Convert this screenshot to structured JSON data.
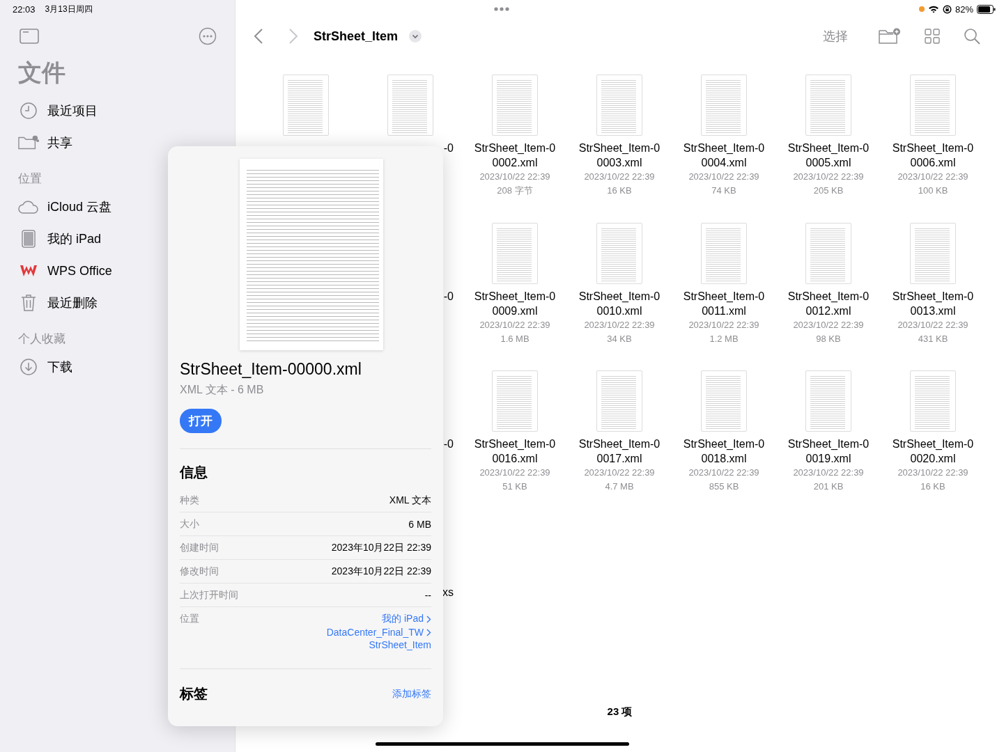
{
  "status_bar": {
    "time": "22:03",
    "date": "3月13日周四",
    "battery": "82%"
  },
  "sidebar": {
    "title": "文件",
    "sections": [
      {
        "items": [
          {
            "label": "最近项目"
          },
          {
            "label": "共享"
          }
        ]
      },
      {
        "header": "位置",
        "items": [
          {
            "label": "iCloud 云盘"
          },
          {
            "label": "我的 iPad"
          },
          {
            "label": "WPS Office"
          },
          {
            "label": "最近删除"
          }
        ]
      },
      {
        "header": "个人收藏",
        "items": [
          {
            "label": "下载"
          }
        ]
      }
    ]
  },
  "toolbar": {
    "title": "StrSheet_Item",
    "select": "选择"
  },
  "grid": [
    [
      {
        "kind": "thumbnail"
      },
      {
        "kind": "thumbnail",
        "fragment": "-0"
      },
      {
        "kind": "file",
        "name_lines": [
          "StrSheet_Item-0",
          "0002.xml"
        ],
        "date": "2023/10/22 22:39",
        "size": "208 字节"
      },
      {
        "kind": "file",
        "name_lines": [
          "StrSheet_Item-0",
          "0003.xml"
        ],
        "date": "2023/10/22 22:39",
        "size": "16 KB"
      },
      {
        "kind": "file",
        "name_lines": [
          "StrSheet_Item-0",
          "0004.xml"
        ],
        "date": "2023/10/22 22:39",
        "size": "74 KB"
      },
      {
        "kind": "file",
        "name_lines": [
          "StrSheet_Item-0",
          "0005.xml"
        ],
        "date": "2023/10/22 22:39",
        "size": "205 KB"
      },
      {
        "kind": "file",
        "name_lines": [
          "StrSheet_Item-0",
          "0006.xml"
        ],
        "date": "2023/10/22 22:39",
        "size": "100 KB"
      }
    ],
    [
      {
        "kind": "hidden"
      },
      {
        "kind": "hidden",
        "fragment": "-0"
      },
      {
        "kind": "file",
        "name_lines": [
          "StrSheet_Item-0",
          "0009.xml"
        ],
        "date": "2023/10/22 22:39",
        "size": "1.6 MB"
      },
      {
        "kind": "file",
        "name_lines": [
          "StrSheet_Item-0",
          "0010.xml"
        ],
        "date": "2023/10/22 22:39",
        "size": "34 KB"
      },
      {
        "kind": "file",
        "name_lines": [
          "StrSheet_Item-0",
          "0011.xml"
        ],
        "date": "2023/10/22 22:39",
        "size": "1.2 MB"
      },
      {
        "kind": "file",
        "name_lines": [
          "StrSheet_Item-0",
          "0012.xml"
        ],
        "date": "2023/10/22 22:39",
        "size": "98 KB"
      },
      {
        "kind": "file",
        "name_lines": [
          "StrSheet_Item-0",
          "0013.xml"
        ],
        "date": "2023/10/22 22:39",
        "size": "431 KB"
      }
    ],
    [
      {
        "kind": "hidden"
      },
      {
        "kind": "hidden",
        "fragment": "-0"
      },
      {
        "kind": "file",
        "name_lines": [
          "StrSheet_Item-0",
          "0016.xml"
        ],
        "date": "2023/10/22 22:39",
        "size": "51 KB"
      },
      {
        "kind": "file",
        "name_lines": [
          "StrSheet_Item-0",
          "0017.xml"
        ],
        "date": "2023/10/22 22:39",
        "size": "4.7 MB"
      },
      {
        "kind": "file",
        "name_lines": [
          "StrSheet_Item-0",
          "0018.xml"
        ],
        "date": "2023/10/22 22:39",
        "size": "855 KB"
      },
      {
        "kind": "file",
        "name_lines": [
          "StrSheet_Item-0",
          "0019.xml"
        ],
        "date": "2023/10/22 22:39",
        "size": "201 KB"
      },
      {
        "kind": "file",
        "name_lines": [
          "StrSheet_Item-0",
          "0020.xml"
        ],
        "date": "2023/10/22 22:39",
        "size": "16 KB"
      }
    ],
    [
      {
        "kind": "hidden"
      },
      {
        "kind": "hidden",
        "fragment": "xs"
      }
    ]
  ],
  "item_count": "23 项",
  "popup": {
    "file_name": "StrSheet_Item-00000.xml",
    "subtitle": "XML 文本 - 6 MB",
    "open_button": "打开",
    "info_title": "信息",
    "info": [
      {
        "label": "种类",
        "value": "XML 文本"
      },
      {
        "label": "大小",
        "value": "6 MB"
      },
      {
        "label": "创建时间",
        "value": "2023年10月22日 22:39"
      },
      {
        "label": "修改时间",
        "value": "2023年10月22日 22:39"
      },
      {
        "label": "上次打开时间",
        "value": "--"
      }
    ],
    "location_label": "位置",
    "location_path": [
      "我的 iPad",
      "DataCenter_Final_TW",
      "StrSheet_Item"
    ],
    "tags_title": "标签",
    "add_tag": "添加标签"
  }
}
